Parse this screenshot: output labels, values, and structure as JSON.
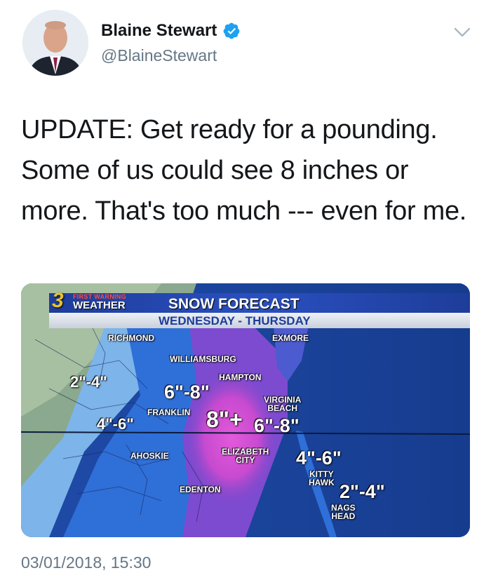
{
  "author": {
    "display_name": "Blaine Stewart",
    "handle": "@BlaineStewart",
    "verified": true,
    "avatar_icon": "avatar-photo"
  },
  "tweet": {
    "text": "UPDATE: Get ready for a pounding. Some of us could see 8 inches or more. That's too much --- even for me.",
    "timestamp": "03/01/2018, 15:30"
  },
  "media": {
    "logo_number": "3",
    "logo_line1": "FIRST WARNING",
    "logo_line2": "WEATHER",
    "title": "SNOW FORECAST",
    "subtitle": "WEDNESDAY - THURSDAY",
    "places": {
      "richmond": "RICHMOND",
      "exmore": "EXMORE",
      "williamsburg": "WILLIAMSBURG",
      "hampton": "HAMPTON",
      "virginia_beach": "VIRGINIA\nBEACH",
      "franklin": "FRANKLIN",
      "ahoskie": "AHOSKIE",
      "elizabeth_city": "ELIZABETH\nCITY",
      "kitty_hawk": "KITTY\nHAWK",
      "edenton": "EDENTON",
      "nags_head": "NAGS\nHEAD"
    },
    "amounts": {
      "west": "2\"-4\"",
      "center_north": "6\"-8\"",
      "southwest": "4\"-6\"",
      "max": "8\"+",
      "beach": "6\"-8\"",
      "obx_north": "4\"-6\"",
      "obx_south": "2\"-4\""
    }
  },
  "colors": {
    "verified": "#1da1f2",
    "handle": "#657786",
    "text": "#14171a"
  }
}
